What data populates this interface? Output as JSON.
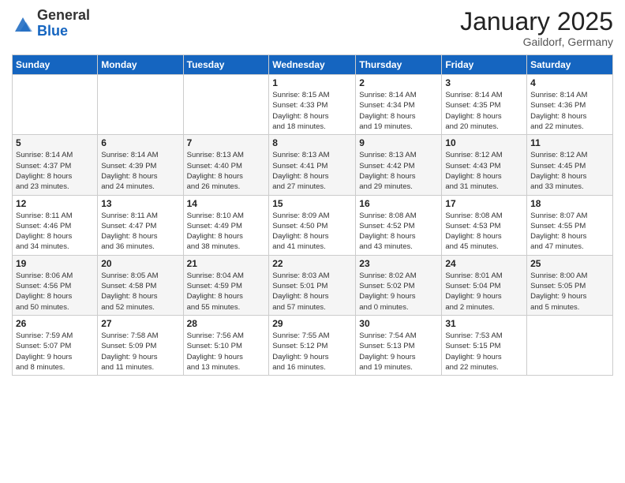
{
  "header": {
    "logo_general": "General",
    "logo_blue": "Blue",
    "month_title": "January 2025",
    "subtitle": "Gaildorf, Germany"
  },
  "days_of_week": [
    "Sunday",
    "Monday",
    "Tuesday",
    "Wednesday",
    "Thursday",
    "Friday",
    "Saturday"
  ],
  "weeks": [
    [
      {
        "day": "",
        "info": ""
      },
      {
        "day": "",
        "info": ""
      },
      {
        "day": "",
        "info": ""
      },
      {
        "day": "1",
        "info": "Sunrise: 8:15 AM\nSunset: 4:33 PM\nDaylight: 8 hours\nand 18 minutes."
      },
      {
        "day": "2",
        "info": "Sunrise: 8:14 AM\nSunset: 4:34 PM\nDaylight: 8 hours\nand 19 minutes."
      },
      {
        "day": "3",
        "info": "Sunrise: 8:14 AM\nSunset: 4:35 PM\nDaylight: 8 hours\nand 20 minutes."
      },
      {
        "day": "4",
        "info": "Sunrise: 8:14 AM\nSunset: 4:36 PM\nDaylight: 8 hours\nand 22 minutes."
      }
    ],
    [
      {
        "day": "5",
        "info": "Sunrise: 8:14 AM\nSunset: 4:37 PM\nDaylight: 8 hours\nand 23 minutes."
      },
      {
        "day": "6",
        "info": "Sunrise: 8:14 AM\nSunset: 4:39 PM\nDaylight: 8 hours\nand 24 minutes."
      },
      {
        "day": "7",
        "info": "Sunrise: 8:13 AM\nSunset: 4:40 PM\nDaylight: 8 hours\nand 26 minutes."
      },
      {
        "day": "8",
        "info": "Sunrise: 8:13 AM\nSunset: 4:41 PM\nDaylight: 8 hours\nand 27 minutes."
      },
      {
        "day": "9",
        "info": "Sunrise: 8:13 AM\nSunset: 4:42 PM\nDaylight: 8 hours\nand 29 minutes."
      },
      {
        "day": "10",
        "info": "Sunrise: 8:12 AM\nSunset: 4:43 PM\nDaylight: 8 hours\nand 31 minutes."
      },
      {
        "day": "11",
        "info": "Sunrise: 8:12 AM\nSunset: 4:45 PM\nDaylight: 8 hours\nand 33 minutes."
      }
    ],
    [
      {
        "day": "12",
        "info": "Sunrise: 8:11 AM\nSunset: 4:46 PM\nDaylight: 8 hours\nand 34 minutes."
      },
      {
        "day": "13",
        "info": "Sunrise: 8:11 AM\nSunset: 4:47 PM\nDaylight: 8 hours\nand 36 minutes."
      },
      {
        "day": "14",
        "info": "Sunrise: 8:10 AM\nSunset: 4:49 PM\nDaylight: 8 hours\nand 38 minutes."
      },
      {
        "day": "15",
        "info": "Sunrise: 8:09 AM\nSunset: 4:50 PM\nDaylight: 8 hours\nand 41 minutes."
      },
      {
        "day": "16",
        "info": "Sunrise: 8:08 AM\nSunset: 4:52 PM\nDaylight: 8 hours\nand 43 minutes."
      },
      {
        "day": "17",
        "info": "Sunrise: 8:08 AM\nSunset: 4:53 PM\nDaylight: 8 hours\nand 45 minutes."
      },
      {
        "day": "18",
        "info": "Sunrise: 8:07 AM\nSunset: 4:55 PM\nDaylight: 8 hours\nand 47 minutes."
      }
    ],
    [
      {
        "day": "19",
        "info": "Sunrise: 8:06 AM\nSunset: 4:56 PM\nDaylight: 8 hours\nand 50 minutes."
      },
      {
        "day": "20",
        "info": "Sunrise: 8:05 AM\nSunset: 4:58 PM\nDaylight: 8 hours\nand 52 minutes."
      },
      {
        "day": "21",
        "info": "Sunrise: 8:04 AM\nSunset: 4:59 PM\nDaylight: 8 hours\nand 55 minutes."
      },
      {
        "day": "22",
        "info": "Sunrise: 8:03 AM\nSunset: 5:01 PM\nDaylight: 8 hours\nand 57 minutes."
      },
      {
        "day": "23",
        "info": "Sunrise: 8:02 AM\nSunset: 5:02 PM\nDaylight: 9 hours\nand 0 minutes."
      },
      {
        "day": "24",
        "info": "Sunrise: 8:01 AM\nSunset: 5:04 PM\nDaylight: 9 hours\nand 2 minutes."
      },
      {
        "day": "25",
        "info": "Sunrise: 8:00 AM\nSunset: 5:05 PM\nDaylight: 9 hours\nand 5 minutes."
      }
    ],
    [
      {
        "day": "26",
        "info": "Sunrise: 7:59 AM\nSunset: 5:07 PM\nDaylight: 9 hours\nand 8 minutes."
      },
      {
        "day": "27",
        "info": "Sunrise: 7:58 AM\nSunset: 5:09 PM\nDaylight: 9 hours\nand 11 minutes."
      },
      {
        "day": "28",
        "info": "Sunrise: 7:56 AM\nSunset: 5:10 PM\nDaylight: 9 hours\nand 13 minutes."
      },
      {
        "day": "29",
        "info": "Sunrise: 7:55 AM\nSunset: 5:12 PM\nDaylight: 9 hours\nand 16 minutes."
      },
      {
        "day": "30",
        "info": "Sunrise: 7:54 AM\nSunset: 5:13 PM\nDaylight: 9 hours\nand 19 minutes."
      },
      {
        "day": "31",
        "info": "Sunrise: 7:53 AM\nSunset: 5:15 PM\nDaylight: 9 hours\nand 22 minutes."
      },
      {
        "day": "",
        "info": ""
      }
    ]
  ]
}
